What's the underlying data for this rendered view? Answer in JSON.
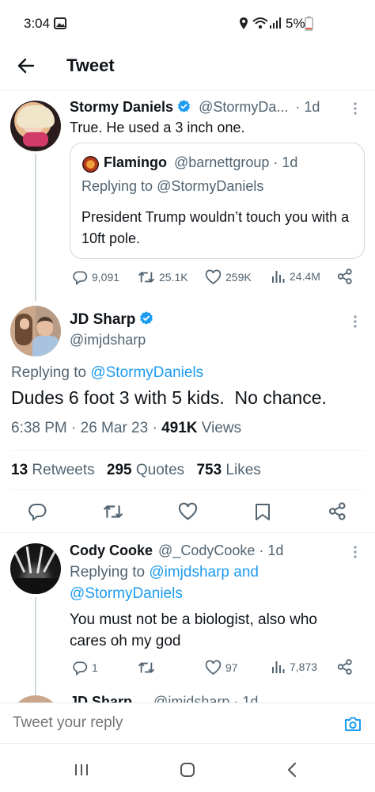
{
  "status_bar": {
    "time": "3:04",
    "battery": "5%"
  },
  "header": {
    "title": "Tweet"
  },
  "parent_tweet": {
    "name": "Stormy Daniels",
    "handle": "@StormyDa...",
    "age": "· 1d",
    "text": "True. He used a 3 inch one.",
    "quoted": {
      "name": "Flamingo",
      "handle": "@barnettgroup",
      "age": "· 1d",
      "replying_prefix": "Replying to",
      "replying_handle": "@StormyDaniels",
      "text": "President Trump wouldn’t touch you with a 10ft pole."
    },
    "stats": {
      "replies": "9,091",
      "retweets": "25.1K",
      "likes": "259K",
      "views": "24.4M"
    }
  },
  "main_tweet": {
    "name": "JD Sharp",
    "handle": "@imjdsharp",
    "replying_prefix": "Replying to",
    "replying_handle": "@StormyDaniels",
    "text": "Dudes 6 foot 3 with 5 kids.  No chance.",
    "timestamp": "6:38 PM · 26 Mar 23 ·",
    "views_count": "491K",
    "views_label": "Views",
    "retweets_count": "13",
    "retweets_label": "Retweets",
    "quotes_count": "295",
    "quotes_label": "Quotes",
    "likes_count": "753",
    "likes_label": "Likes"
  },
  "reply": {
    "name": "Cody Cooke",
    "handle": "@_CodyCooke",
    "age": "· 1d",
    "replying_prefix": "Replying to",
    "replying_handles": "@imjdsharp and",
    "replying_handles_2": "@StormyDaniels",
    "text": "You must not be a biologist, also who cares oh my god",
    "stats": {
      "replies": "1",
      "likes": "97",
      "views": "7,873"
    }
  },
  "next_reply_peek": {
    "name": "JD Sharp",
    "handle": "@imjdsharp",
    "age": "· 1d"
  },
  "composer": {
    "placeholder": "Tweet your reply"
  },
  "colors": {
    "accent": "#1d9bf0",
    "muted": "#536471",
    "text": "#0f1419"
  }
}
